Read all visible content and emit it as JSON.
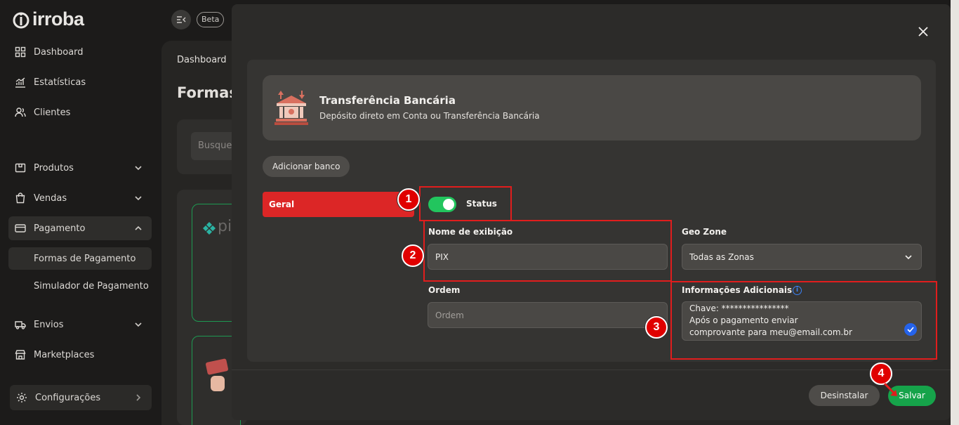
{
  "brand": {
    "name": "irroba"
  },
  "topbar": {
    "badge": "Beta"
  },
  "sidebar": {
    "items": [
      {
        "label": "Dashboard"
      },
      {
        "label": "Estatísticas"
      },
      {
        "label": "Clientes"
      },
      {
        "label": "Produtos"
      },
      {
        "label": "Vendas"
      },
      {
        "label": "Pagamento"
      },
      {
        "label": "Envios"
      },
      {
        "label": "Marketplaces"
      }
    ],
    "sub_items": [
      {
        "label": "Formas de Pagamento"
      },
      {
        "label": "Simulador de Pagamento"
      }
    ],
    "config": "Configurações"
  },
  "background_page": {
    "breadcrumb": "Dashboard",
    "title": "Formas",
    "search_placeholder": "Busque",
    "card_text": "pi"
  },
  "modal": {
    "header": {
      "title": "Transferência Bancária",
      "subtitle": "Depósito direto em Conta ou Transferência Bancária"
    },
    "add_bank": "Adicionar banco",
    "tab": "Geral",
    "status_label": "Status",
    "status_on": true,
    "display_name_label": "Nome de exibição",
    "display_name_value": "PIX",
    "geo_zone_label": "Geo Zone",
    "geo_zone_value": "Todas as Zonas",
    "order_label": "Ordem",
    "order_placeholder": "Ordem",
    "info_label": "Informações Adicionais",
    "info_lines": [
      "Chave: ****************",
      "Após o pagamento enviar",
      "comprovante para meu@email.com.br"
    ],
    "buttons": {
      "uninstall": "Desinstalar",
      "save": "Salvar"
    }
  },
  "annotations": [
    "1",
    "2",
    "3",
    "4"
  ],
  "colors": {
    "accent_red": "#dc2626",
    "toggle_green": "#22c55e",
    "save_green": "#16a34a",
    "annotation_red": "#e11d1d"
  }
}
